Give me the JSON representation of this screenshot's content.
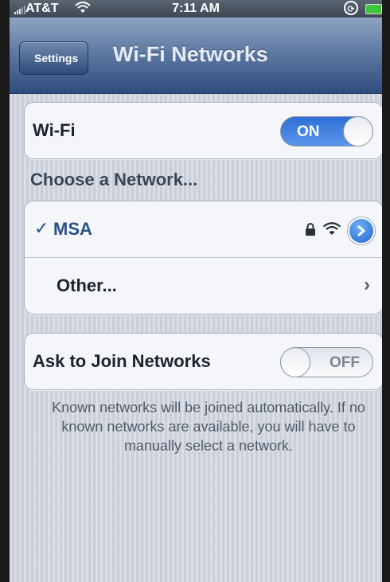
{
  "status_bar": {
    "carrier": "AT&T",
    "time": "7:11 AM",
    "wifi_icon": "wifi-icon",
    "battery_color": "#3fc43f"
  },
  "nav": {
    "back_label": "Settings",
    "title": "Wi-Fi Networks"
  },
  "wifi": {
    "label": "Wi-Fi",
    "toggle": "ON"
  },
  "networks": {
    "header": "Choose a Network...",
    "items": [
      {
        "check": "✓",
        "name": "MSA",
        "icons": [
          "lock-icon",
          "wifi-signal-icon",
          "detail-disclosure-icon"
        ]
      }
    ],
    "other_label": "Other..."
  },
  "ask_to_join": {
    "label": "Ask to Join Networks",
    "toggle": "OFF"
  },
  "footer": {
    "text": "Known networks will be joined automatically. If no known networks are available, you will have to manually select a network."
  },
  "colors": {
    "accent_blue": "#2f6fd6",
    "selected_text": "#2b4f87",
    "nav_bar": "#5f7aa3"
  }
}
